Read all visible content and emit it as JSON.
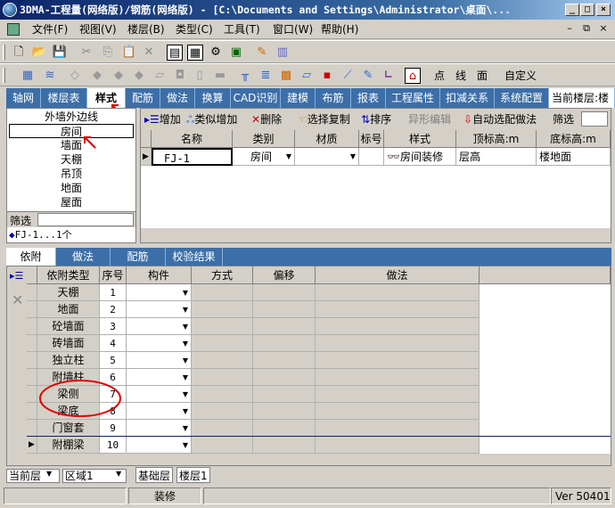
{
  "window": {
    "title": "3DMA-工程量(网络版)/钢筋(网络版) - [C:\\Documents and Settings\\Administrator\\桌面\\..."
  },
  "menu": [
    "文件(F)",
    "视图(V)",
    "楼层(B)",
    "类型(C)",
    "工具(T)",
    "窗口(W)",
    "帮助(H)"
  ],
  "toolbar2": {
    "point": "点",
    "line": "线",
    "face": "面",
    "custom": "自定义"
  },
  "tabs": [
    "轴网",
    "楼层表",
    "样式",
    "配筋",
    "做法",
    "换算",
    "CAD识别",
    "建模",
    "布筋",
    "报表",
    "工程属性",
    "扣减关系",
    "系统配置",
    "当前楼层:楼"
  ],
  "leftList": [
    "外墙外边线",
    "房间",
    "墙面",
    "天棚",
    "吊顶",
    "地面",
    "屋面"
  ],
  "filter": {
    "label": "筛选",
    "item": "FJ-1...1个"
  },
  "topButtons": {
    "add": "增加",
    "similar": "类似增加",
    "delete": "删除",
    "copy": "选择复制",
    "sort": "排序",
    "shape": "异形编辑",
    "auto": "自动选配做法",
    "filter": "筛选"
  },
  "topHeaders": [
    "名称",
    "类别",
    "材质",
    "标号",
    "样式",
    "顶标高:m",
    "底标高:m"
  ],
  "topRow": {
    "name": "FJ-1",
    "category": "房间",
    "style": "房间装修",
    "top": "层高",
    "bottom": "楼地面"
  },
  "bottomTabs": [
    "依附",
    "做法",
    "配筋",
    "校验结果"
  ],
  "bottomHeaders": [
    "依附类型",
    "序号",
    "构件",
    "方式",
    "偏移",
    "做法"
  ],
  "bottomRows": [
    {
      "type": "天棚",
      "no": "1"
    },
    {
      "type": "地面",
      "no": "2"
    },
    {
      "type": "砼墙面",
      "no": "3"
    },
    {
      "type": "砖墙面",
      "no": "4"
    },
    {
      "type": "独立柱",
      "no": "5"
    },
    {
      "type": "附墙柱",
      "no": "6"
    },
    {
      "type": "梁侧",
      "no": "7"
    },
    {
      "type": "梁底",
      "no": "8"
    },
    {
      "type": "门窗套",
      "no": "9"
    },
    {
      "type": "附棚梁",
      "no": "10"
    }
  ],
  "status": {
    "floor": "当前层",
    "region": "区域1",
    "layer1": "基础层",
    "layer2": "楼层1",
    "mode": "装修",
    "version": "Ver 50401"
  },
  "colors": {
    "tab_bg": "#3c6ea8",
    "title_start": "#0a246a",
    "annotation": "#e00000"
  }
}
